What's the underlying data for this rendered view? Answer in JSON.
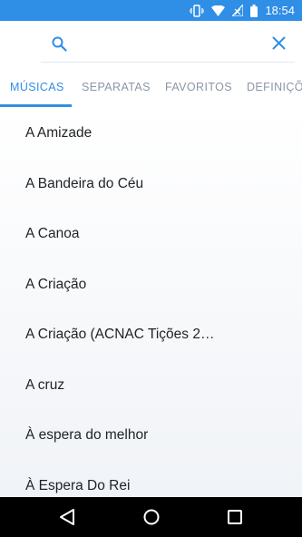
{
  "status_bar": {
    "time": "18:54",
    "icons": [
      "vibrate-icon",
      "wifi-icon",
      "no-signal-icon",
      "battery-icon"
    ],
    "background_color": "#2f8ee6"
  },
  "search": {
    "value": "",
    "placeholder": "",
    "accent_color": "#2f8ee6"
  },
  "tabs": [
    {
      "label": "MÚSICAS",
      "active": true
    },
    {
      "label": "SEPARATAS",
      "active": false
    },
    {
      "label": "FAVORITOS",
      "active": false
    },
    {
      "label": "DEFINIÇÕES",
      "active": false
    }
  ],
  "songs": [
    "A Amizade",
    "A Bandeira do Céu",
    "A Canoa",
    "A Criação",
    "A Criação (ACNAC Tições 2…",
    "A cruz",
    "À espera do melhor",
    "À Espera Do Rei"
  ],
  "nav_bar": {
    "buttons": [
      "back-icon",
      "home-icon",
      "recents-icon"
    ]
  }
}
